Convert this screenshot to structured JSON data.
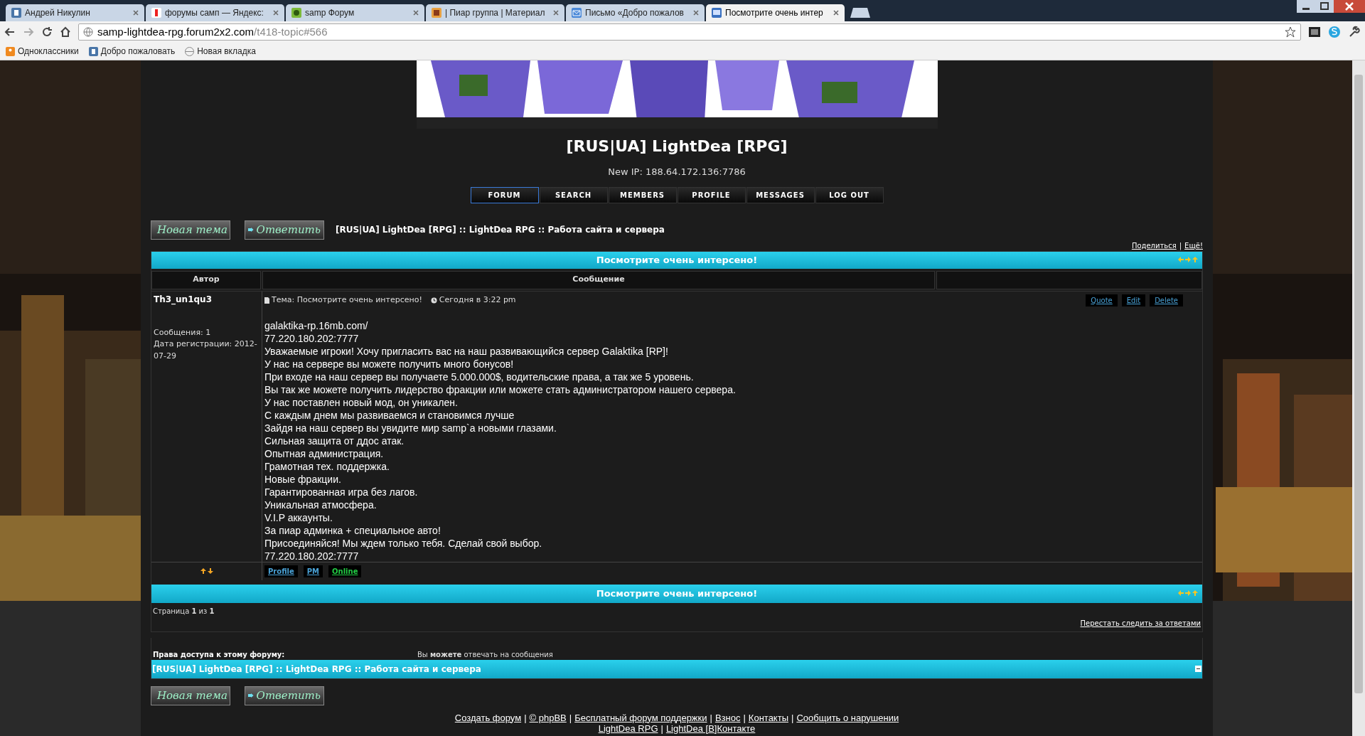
{
  "browser": {
    "tabs": [
      {
        "title": "Андрей Никулин",
        "selected": false
      },
      {
        "title": "форумы самп — Яндекс:",
        "selected": false
      },
      {
        "title": "samp Форум",
        "selected": false
      },
      {
        "title": "| Пиар группа | Материал",
        "selected": false
      },
      {
        "title": "Письмо «Добро пожалов",
        "selected": false
      },
      {
        "title": "Посмотрите очень интер",
        "selected": true
      }
    ],
    "address": {
      "host": "samp-lightdea-rpg.forum2x2.com",
      "path": "/t418-topic#566"
    },
    "bookmarks": [
      "Одноклассники",
      "Добро пожаловать",
      "Новая вкладка"
    ]
  },
  "forum": {
    "site_title": "[RUS|UA] LightDea [RPG]",
    "new_ip": "New IP: 188.64.172.136:7786",
    "nav": [
      {
        "label": "FORUM",
        "selected": true
      },
      {
        "label": "SEARCH",
        "selected": false
      },
      {
        "label": "MEMBERS",
        "selected": false
      },
      {
        "label": "PROFILE",
        "selected": false
      },
      {
        "label": "MESSAGES",
        "selected": false
      },
      {
        "label": "LOG OUT",
        "selected": false
      }
    ],
    "buttons_top": [
      "Новая тема",
      "Ответить"
    ],
    "breadcrumb": "[RUS|UA] LightDea [RPG] :: LightDea RPG :: Работа сайта и сервера",
    "share_links": [
      {
        "kind": "link",
        "text": "Поделиться"
      },
      {
        "kind": "separator",
        "text": "|"
      },
      {
        "kind": "link",
        "text": "Ещё!"
      }
    ],
    "topic_title_top": "Посмотрите очень интерсено!",
    "columns": [
      "Автор",
      "Сообщение"
    ],
    "post": {
      "author": "Th3_un1qu3",
      "posts_count": "Сообщения: 1",
      "registered": "Дата регистрации: 2012-07-29",
      "subject": "Тема: Посмотрите очень интерсено!",
      "time": "Сегодня в 3:22 pm",
      "actions": [
        "Quote",
        "Edit",
        "Delete"
      ],
      "lines": [
        "galaktika-rp.16mb.com/",
        "77.220.180.202:7777",
        "Уважаемые игроки! Хочу пригласить вас на наш развивающийся сервер Galaktika [RP]!",
        "У нас на сервере вы можете получить много бонусов!",
        "При входе на наш сервер вы получаете 5.000.000$, водительские права, а так же 5 уровень.",
        "Вы так же можете получить лидерство фракции или можете стать администратором нашего сервера.",
        "У нас поставлен новый мод, он уникален.",
        "С каждым днем мы развиваемся и становимся лучше",
        "Зайдя на наш сервер вы увидите мир samp`а новыми глазами.",
        "Сильная защита от ддос атак.",
        "Опытная администрация.",
        "Грамотная тех. поддержка.",
        "Новые фракции.",
        "Гарантированная игра без лагов.",
        "Уникальная атмосфера.",
        "V.I.P аккаунты.",
        "За пиар админка + специальное авто!",
        "Присоединяйся! Мы ждем только тебя. Сделай свой выбор.",
        "77.220.180.202:7777"
      ],
      "profile_buttons": [
        {
          "label": "Profile",
          "color": "#4aa3d8"
        },
        {
          "label": "PM",
          "color": "#4aa3d8"
        },
        {
          "label": "Online",
          "color": "#22cc44"
        }
      ]
    },
    "topic_title_bottom": "Посмотрите очень интерсено!",
    "pagination": "Страница **1** из **1**",
    "unwatch_link": "Перестать следить за ответами",
    "permissions_label": "Права доступа к этому форуму:",
    "permissions_text": "Вы **можете** отвечать на сообщения",
    "forum_bar": "[RUS|UA] LightDea [RPG] :: LightDea RPG :: Работа сайта и сервера",
    "buttons_bottom": [
      "Новая тема",
      "Ответить"
    ],
    "footer_links": [
      [
        {
          "kind": "link",
          "text": "Создать форум"
        },
        {
          "kind": "separator",
          "text": "|"
        },
        {
          "kind": "link",
          "text": "© phpBB"
        },
        {
          "kind": "separator",
          "text": "|"
        },
        {
          "kind": "link",
          "text": "Бесплатный форум поддержки"
        },
        {
          "kind": "separator",
          "text": "|"
        },
        {
          "kind": "link",
          "text": "Взнос"
        },
        {
          "kind": "separator",
          "text": "|"
        },
        {
          "kind": "link",
          "text": "Контакты"
        },
        {
          "kind": "separator",
          "text": "|"
        },
        {
          "kind": "link",
          "text": "Сообщить о нарушении"
        }
      ],
      [
        {
          "kind": "link",
          "text": "LightDea RPG"
        },
        {
          "kind": "separator",
          "text": "|"
        },
        {
          "kind": "link",
          "text": "LightDea [В]Контакте"
        }
      ]
    ]
  }
}
